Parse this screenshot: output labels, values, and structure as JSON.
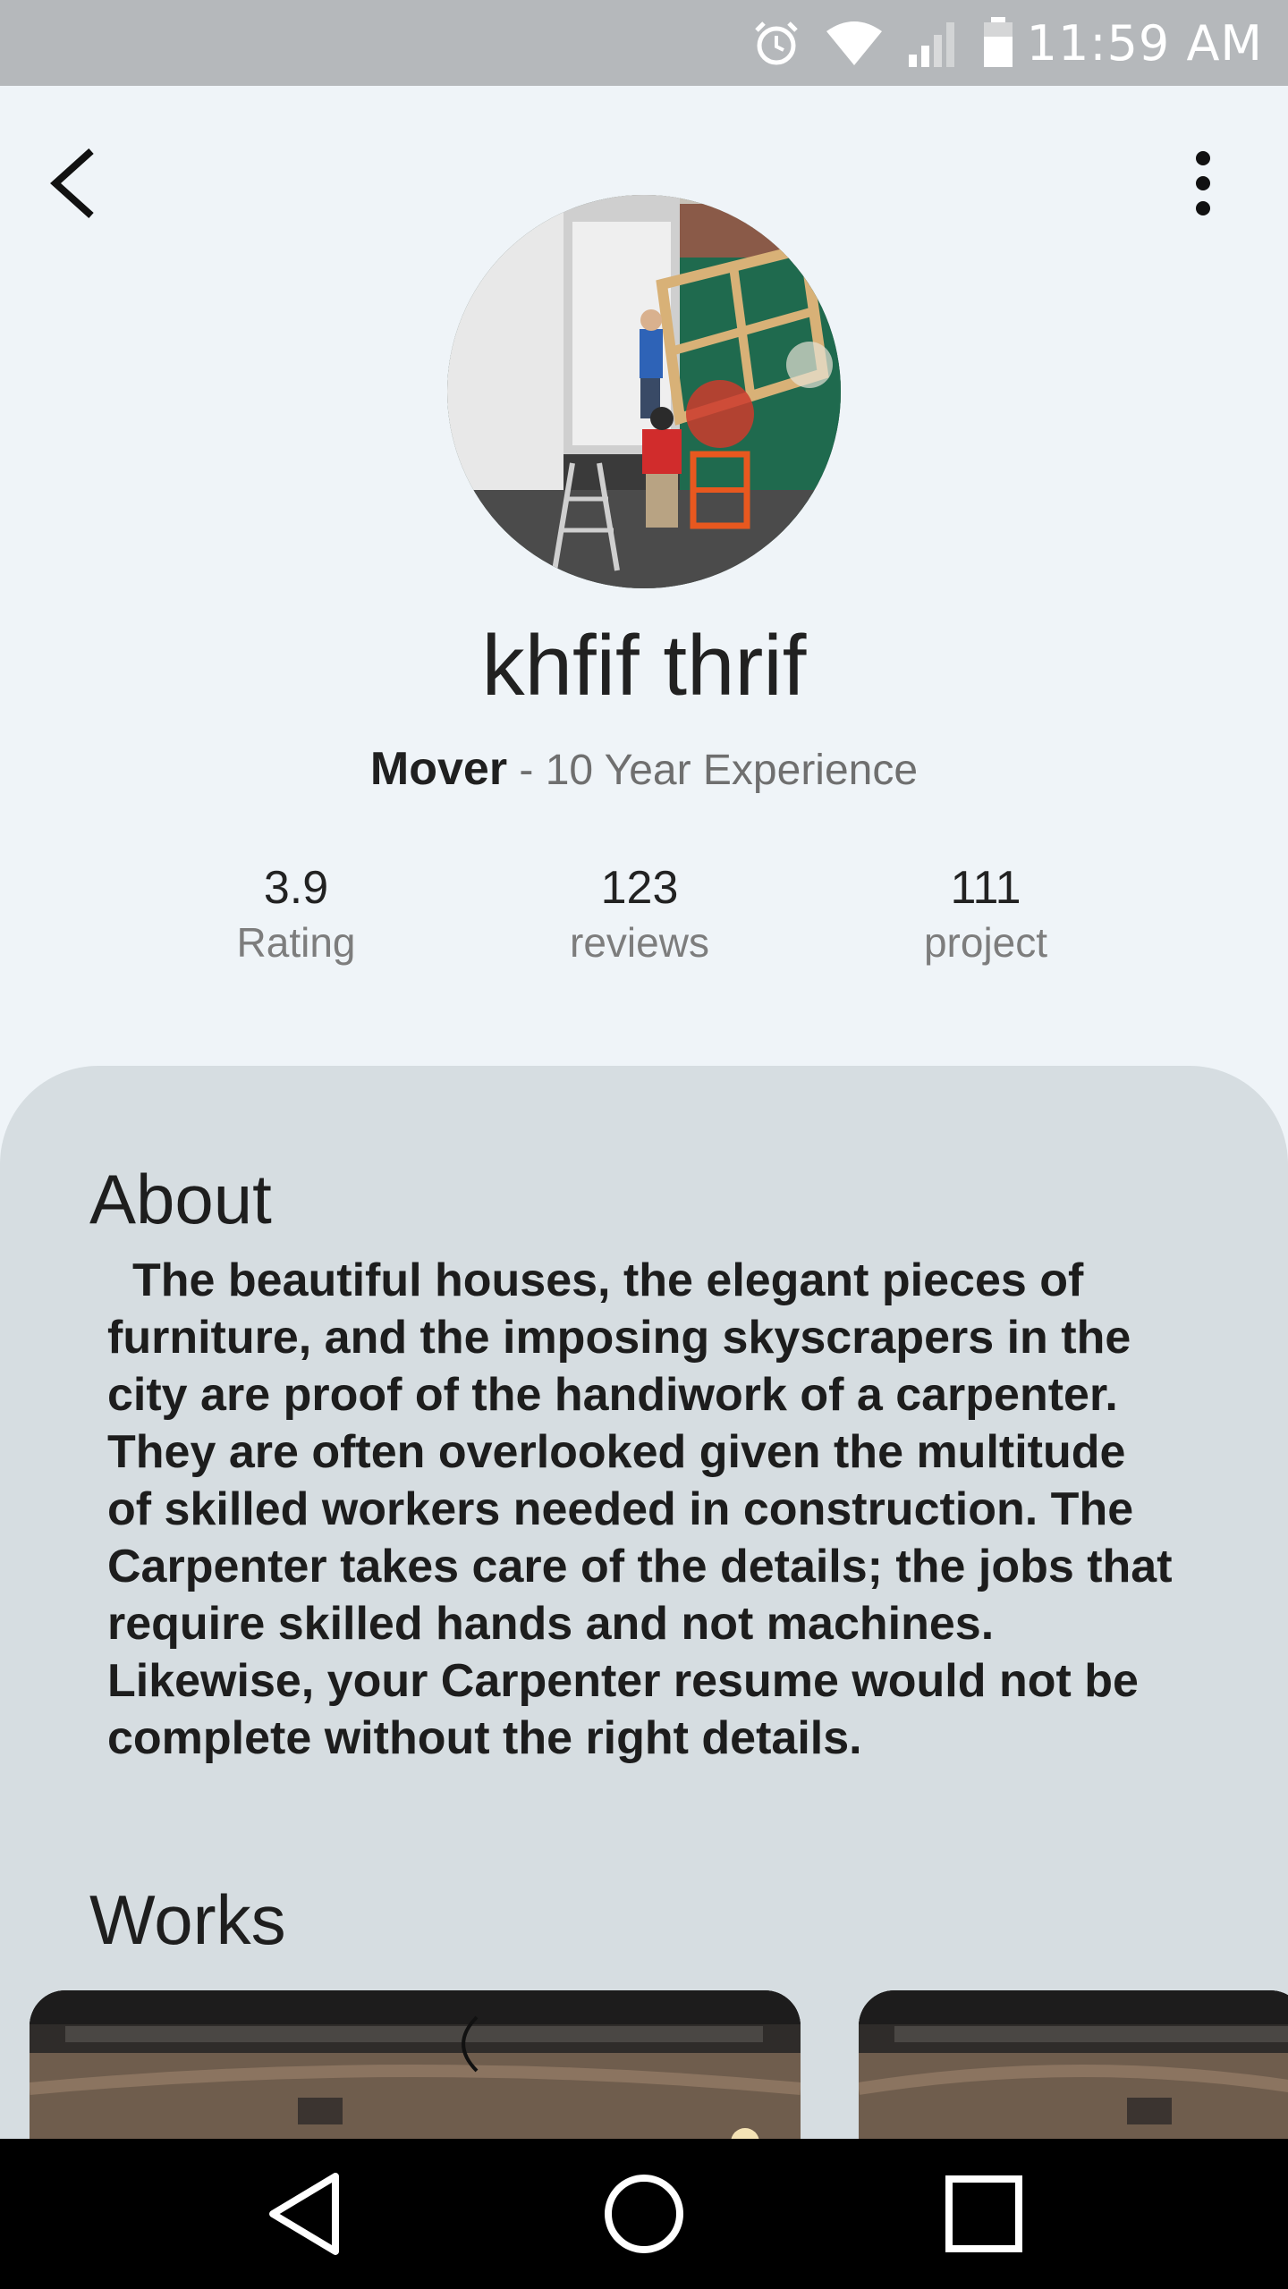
{
  "status_bar": {
    "time": "11:59 AM"
  },
  "profile": {
    "name": "khfif thrif",
    "role": "Mover",
    "experience": " - 10 Year Experience"
  },
  "stats": [
    {
      "value": "3.9",
      "label": "Rating"
    },
    {
      "value": "123",
      "label": "reviews"
    },
    {
      "value": "111",
      "label": "project"
    }
  ],
  "about": {
    "title": "About",
    "text": "The beautiful houses, the elegant pieces of furniture, and the imposing skyscrapers in the city are proof of the handiwork of a carpenter. They are often overlooked given the multitude of skilled workers needed in construction. The Carpenter takes care of the details; the jobs that require skilled hands and not machines. Likewise, your Carpenter resume would not be complete without the right details."
  },
  "works": {
    "title": "Works"
  }
}
